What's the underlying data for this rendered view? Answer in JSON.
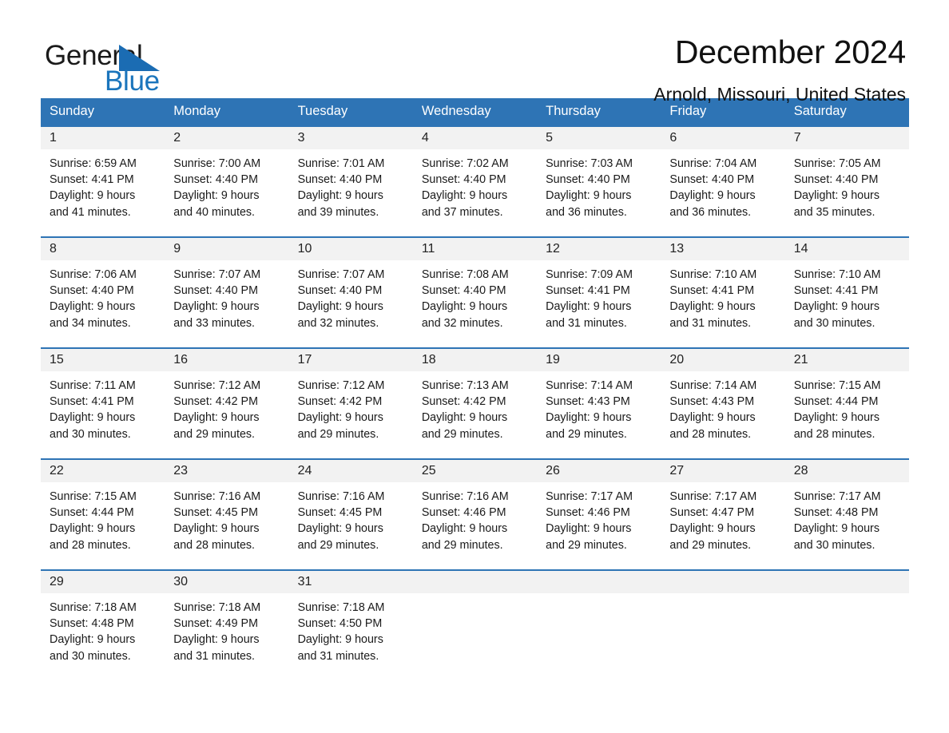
{
  "brand": {
    "word_general": "General",
    "word_blue": "Blue",
    "triangle_color": "#1b6cb3",
    "blue_text_color": "#1b75bc"
  },
  "header": {
    "month_title": "December 2024",
    "location": "Arnold, Missouri, United States"
  },
  "theme": {
    "header_row_bg": "#2e74b5",
    "day_number_bg": "#f2f2f2",
    "week_divider": "#2e74b5",
    "text": "#1a1a1a"
  },
  "weekday_headers": [
    "Sunday",
    "Monday",
    "Tuesday",
    "Wednesday",
    "Thursday",
    "Friday",
    "Saturday"
  ],
  "labels": {
    "sunrise_prefix": "Sunrise:",
    "sunset_prefix": "Sunset:",
    "daylight_prefix": "Daylight:"
  },
  "weeks": [
    [
      {
        "day": "1",
        "sunrise": "Sunrise: 6:59 AM",
        "sunset": "Sunset: 4:41 PM",
        "daylight_line1": "Daylight: 9 hours",
        "daylight_line2": "and 41 minutes."
      },
      {
        "day": "2",
        "sunrise": "Sunrise: 7:00 AM",
        "sunset": "Sunset: 4:40 PM",
        "daylight_line1": "Daylight: 9 hours",
        "daylight_line2": "and 40 minutes."
      },
      {
        "day": "3",
        "sunrise": "Sunrise: 7:01 AM",
        "sunset": "Sunset: 4:40 PM",
        "daylight_line1": "Daylight: 9 hours",
        "daylight_line2": "and 39 minutes."
      },
      {
        "day": "4",
        "sunrise": "Sunrise: 7:02 AM",
        "sunset": "Sunset: 4:40 PM",
        "daylight_line1": "Daylight: 9 hours",
        "daylight_line2": "and 37 minutes."
      },
      {
        "day": "5",
        "sunrise": "Sunrise: 7:03 AM",
        "sunset": "Sunset: 4:40 PM",
        "daylight_line1": "Daylight: 9 hours",
        "daylight_line2": "and 36 minutes."
      },
      {
        "day": "6",
        "sunrise": "Sunrise: 7:04 AM",
        "sunset": "Sunset: 4:40 PM",
        "daylight_line1": "Daylight: 9 hours",
        "daylight_line2": "and 36 minutes."
      },
      {
        "day": "7",
        "sunrise": "Sunrise: 7:05 AM",
        "sunset": "Sunset: 4:40 PM",
        "daylight_line1": "Daylight: 9 hours",
        "daylight_line2": "and 35 minutes."
      }
    ],
    [
      {
        "day": "8",
        "sunrise": "Sunrise: 7:06 AM",
        "sunset": "Sunset: 4:40 PM",
        "daylight_line1": "Daylight: 9 hours",
        "daylight_line2": "and 34 minutes."
      },
      {
        "day": "9",
        "sunrise": "Sunrise: 7:07 AM",
        "sunset": "Sunset: 4:40 PM",
        "daylight_line1": "Daylight: 9 hours",
        "daylight_line2": "and 33 minutes."
      },
      {
        "day": "10",
        "sunrise": "Sunrise: 7:07 AM",
        "sunset": "Sunset: 4:40 PM",
        "daylight_line1": "Daylight: 9 hours",
        "daylight_line2": "and 32 minutes."
      },
      {
        "day": "11",
        "sunrise": "Sunrise: 7:08 AM",
        "sunset": "Sunset: 4:40 PM",
        "daylight_line1": "Daylight: 9 hours",
        "daylight_line2": "and 32 minutes."
      },
      {
        "day": "12",
        "sunrise": "Sunrise: 7:09 AM",
        "sunset": "Sunset: 4:41 PM",
        "daylight_line1": "Daylight: 9 hours",
        "daylight_line2": "and 31 minutes."
      },
      {
        "day": "13",
        "sunrise": "Sunrise: 7:10 AM",
        "sunset": "Sunset: 4:41 PM",
        "daylight_line1": "Daylight: 9 hours",
        "daylight_line2": "and 31 minutes."
      },
      {
        "day": "14",
        "sunrise": "Sunrise: 7:10 AM",
        "sunset": "Sunset: 4:41 PM",
        "daylight_line1": "Daylight: 9 hours",
        "daylight_line2": "and 30 minutes."
      }
    ],
    [
      {
        "day": "15",
        "sunrise": "Sunrise: 7:11 AM",
        "sunset": "Sunset: 4:41 PM",
        "daylight_line1": "Daylight: 9 hours",
        "daylight_line2": "and 30 minutes."
      },
      {
        "day": "16",
        "sunrise": "Sunrise: 7:12 AM",
        "sunset": "Sunset: 4:42 PM",
        "daylight_line1": "Daylight: 9 hours",
        "daylight_line2": "and 29 minutes."
      },
      {
        "day": "17",
        "sunrise": "Sunrise: 7:12 AM",
        "sunset": "Sunset: 4:42 PM",
        "daylight_line1": "Daylight: 9 hours",
        "daylight_line2": "and 29 minutes."
      },
      {
        "day": "18",
        "sunrise": "Sunrise: 7:13 AM",
        "sunset": "Sunset: 4:42 PM",
        "daylight_line1": "Daylight: 9 hours",
        "daylight_line2": "and 29 minutes."
      },
      {
        "day": "19",
        "sunrise": "Sunrise: 7:14 AM",
        "sunset": "Sunset: 4:43 PM",
        "daylight_line1": "Daylight: 9 hours",
        "daylight_line2": "and 29 minutes."
      },
      {
        "day": "20",
        "sunrise": "Sunrise: 7:14 AM",
        "sunset": "Sunset: 4:43 PM",
        "daylight_line1": "Daylight: 9 hours",
        "daylight_line2": "and 28 minutes."
      },
      {
        "day": "21",
        "sunrise": "Sunrise: 7:15 AM",
        "sunset": "Sunset: 4:44 PM",
        "daylight_line1": "Daylight: 9 hours",
        "daylight_line2": "and 28 minutes."
      }
    ],
    [
      {
        "day": "22",
        "sunrise": "Sunrise: 7:15 AM",
        "sunset": "Sunset: 4:44 PM",
        "daylight_line1": "Daylight: 9 hours",
        "daylight_line2": "and 28 minutes."
      },
      {
        "day": "23",
        "sunrise": "Sunrise: 7:16 AM",
        "sunset": "Sunset: 4:45 PM",
        "daylight_line1": "Daylight: 9 hours",
        "daylight_line2": "and 28 minutes."
      },
      {
        "day": "24",
        "sunrise": "Sunrise: 7:16 AM",
        "sunset": "Sunset: 4:45 PM",
        "daylight_line1": "Daylight: 9 hours",
        "daylight_line2": "and 29 minutes."
      },
      {
        "day": "25",
        "sunrise": "Sunrise: 7:16 AM",
        "sunset": "Sunset: 4:46 PM",
        "daylight_line1": "Daylight: 9 hours",
        "daylight_line2": "and 29 minutes."
      },
      {
        "day": "26",
        "sunrise": "Sunrise: 7:17 AM",
        "sunset": "Sunset: 4:46 PM",
        "daylight_line1": "Daylight: 9 hours",
        "daylight_line2": "and 29 minutes."
      },
      {
        "day": "27",
        "sunrise": "Sunrise: 7:17 AM",
        "sunset": "Sunset: 4:47 PM",
        "daylight_line1": "Daylight: 9 hours",
        "daylight_line2": "and 29 minutes."
      },
      {
        "day": "28",
        "sunrise": "Sunrise: 7:17 AM",
        "sunset": "Sunset: 4:48 PM",
        "daylight_line1": "Daylight: 9 hours",
        "daylight_line2": "and 30 minutes."
      }
    ],
    [
      {
        "day": "29",
        "sunrise": "Sunrise: 7:18 AM",
        "sunset": "Sunset: 4:48 PM",
        "daylight_line1": "Daylight: 9 hours",
        "daylight_line2": "and 30 minutes."
      },
      {
        "day": "30",
        "sunrise": "Sunrise: 7:18 AM",
        "sunset": "Sunset: 4:49 PM",
        "daylight_line1": "Daylight: 9 hours",
        "daylight_line2": "and 31 minutes."
      },
      {
        "day": "31",
        "sunrise": "Sunrise: 7:18 AM",
        "sunset": "Sunset: 4:50 PM",
        "daylight_line1": "Daylight: 9 hours",
        "daylight_line2": "and 31 minutes."
      },
      {
        "day": "",
        "sunrise": "",
        "sunset": "",
        "daylight_line1": "",
        "daylight_line2": ""
      },
      {
        "day": "",
        "sunrise": "",
        "sunset": "",
        "daylight_line1": "",
        "daylight_line2": ""
      },
      {
        "day": "",
        "sunrise": "",
        "sunset": "",
        "daylight_line1": "",
        "daylight_line2": ""
      },
      {
        "day": "",
        "sunrise": "",
        "sunset": "",
        "daylight_line1": "",
        "daylight_line2": ""
      }
    ]
  ]
}
